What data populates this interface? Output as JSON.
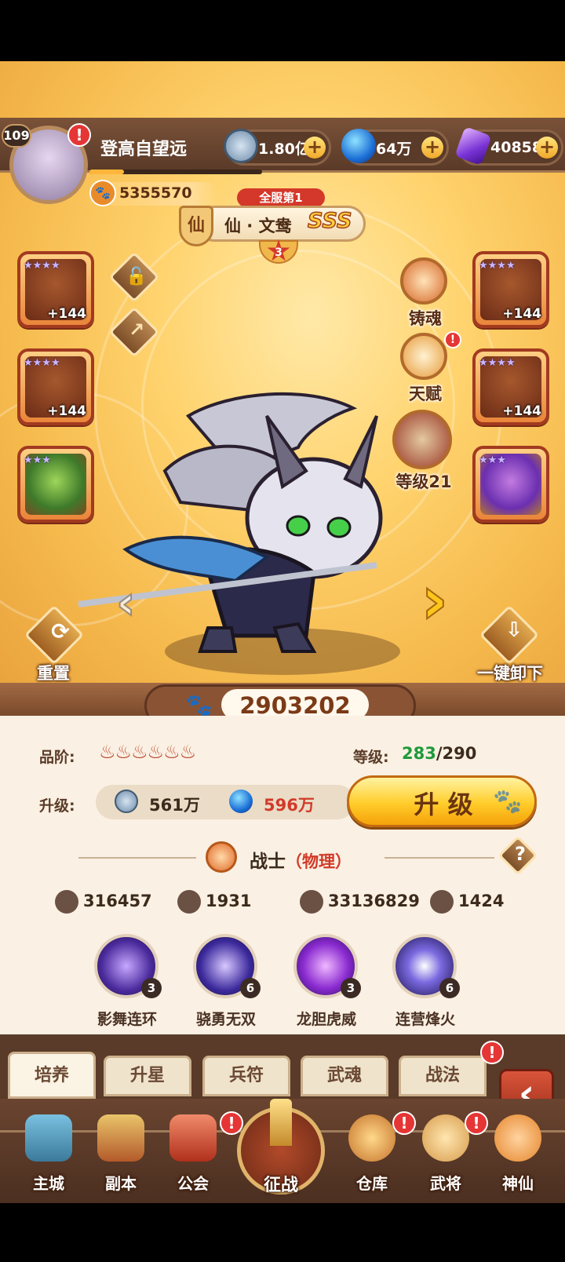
{
  "player": {
    "level": "109",
    "name": "登高自望远",
    "power": "5355570"
  },
  "resources": {
    "copper": "1.80亿",
    "orb": "64万",
    "gem": "40858"
  },
  "hero": {
    "rank_tag": "全服第1",
    "faction_char": "仙",
    "name": "仙 · 文鸯",
    "grade": "SSS",
    "star_count": "3",
    "power": "2903202"
  },
  "side_actions": {
    "soul_forge": "铸魂",
    "talent": "天赋",
    "weapon_level": "等级21"
  },
  "equipment_levels": [
    "+144",
    "+144",
    "+144",
    "+144"
  ],
  "controls": {
    "reset": "重置",
    "unequip_all": "一键卸下"
  },
  "stats_panel": {
    "quality_label": "品阶:",
    "level_label": "等级:",
    "level_current": "283",
    "level_max": "/290",
    "upgrade_label": "升级:",
    "upgrade_cost_copper": "561万",
    "upgrade_cost_orb": "596万",
    "upgrade_button": "升 级",
    "class_name": "战士",
    "class_type": "（物理）",
    "help": "?",
    "attack": "316457",
    "defense": "1931",
    "hp": "33136829",
    "speed": "1424"
  },
  "skills": [
    {
      "name": "影舞连环",
      "level": "3"
    },
    {
      "name": "骁勇无双",
      "level": "6"
    },
    {
      "name": "龙胆虎威",
      "level": "3"
    },
    {
      "name": "连营烽火",
      "level": "6"
    }
  ],
  "tabs": [
    "培养",
    "升星",
    "兵符",
    "武魂",
    "战法"
  ],
  "nav": [
    "主城",
    "副本",
    "公会",
    "征战",
    "仓库",
    "武将",
    "神仙"
  ],
  "colors": {
    "level_green": "#1e9a3a",
    "cost_red": "#d23a2a",
    "panel_bg": "#faf0e3",
    "brand_gold": "#f5b94c"
  }
}
